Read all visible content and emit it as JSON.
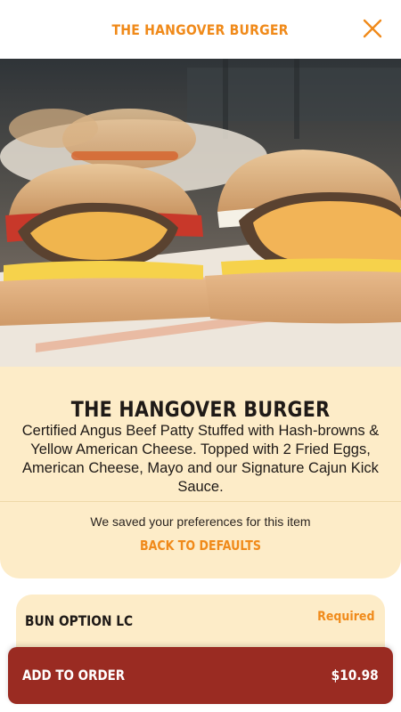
{
  "header": {
    "title": "THE HANGOVER BURGER",
    "close_icon": "close-icon",
    "accent_color": "#f08a1a"
  },
  "hero": {
    "image": "burger-photo"
  },
  "item": {
    "title": "THE HANGOVER BURGER",
    "description": "Certified Angus Beef Patty Stuffed with Hash-browns & Yellow American Cheese. Topped with 2 Fried Eggs, American Cheese, Mayo and our Signature Cajun Kick Sauce.",
    "preferences_note": "We saved your preferences for this item",
    "defaults_label": "BACK TO DEFAULTS"
  },
  "option_group": {
    "title": "BUN OPTION LC",
    "required_label": "Required"
  },
  "add_to_order": {
    "label": "ADD TO ORDER",
    "price": "$10.98",
    "color": "#9a2b22"
  }
}
